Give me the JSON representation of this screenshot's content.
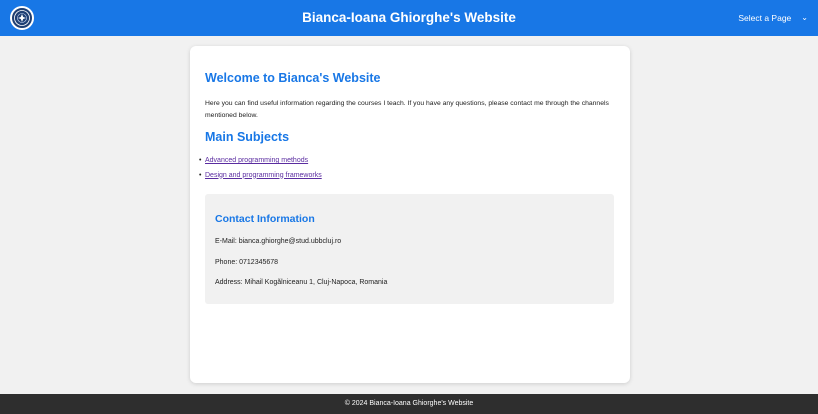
{
  "header": {
    "logo_icon": "university-seal-icon",
    "title": "Bianca-Ioana Ghiorghe's Website",
    "page_select_label": "Select a Page",
    "page_select_icon": "chevron-down-icon",
    "background_color": "#1877e6"
  },
  "main": {
    "welcome_heading": "Welcome to Bianca's Website",
    "intro_text": "Here you can find useful information regarding the courses I teach. If you have any questions, please contact me through the channels mentioned below.",
    "subjects_heading": "Main Subjects",
    "subjects": [
      {
        "label": "Advanced programming methods"
      },
      {
        "label": "Design and programming frameworks"
      }
    ],
    "accent_color": "#1877e6",
    "link_color": "#5a2ca0"
  },
  "contact": {
    "heading": "Contact Information",
    "email_line": "E-Mail: bianca.ghiorghe@stud.ubbcluj.ro",
    "phone_line": "Phone: 0712345678",
    "address_line": "Address: Mihail Kogălniceanu 1, Cluj-Napoca, Romania"
  },
  "footer": {
    "text": "© 2024 Bianca-Ioana Ghiorghe's Website"
  }
}
